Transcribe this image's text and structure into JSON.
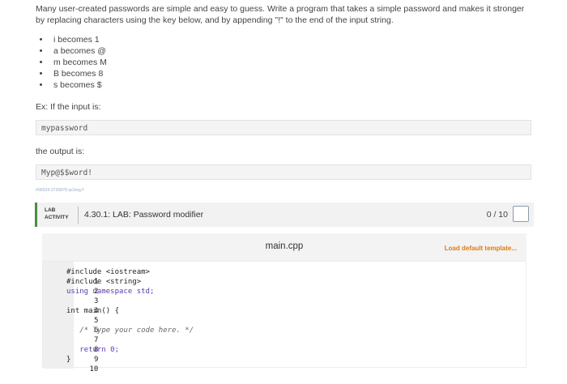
{
  "intro": "Many user-created passwords are simple and easy to guess. Write a program that takes a simple password and makes it stronger by replacing characters using the key below, and by appending \"!\" to the end of the input string.",
  "rules": [
    "i becomes 1",
    "a becomes @",
    "m becomes M",
    "B becomes 8",
    "s becomes $"
  ],
  "example_label": "Ex: If the input is:",
  "example_input": "mypassword",
  "output_label": "the output is:",
  "example_output": "Myp@$$word!",
  "tracking_id": "#96024.3735878.qx3zqy7",
  "lab": {
    "tag_line1": "LAB",
    "tag_line2": "ACTIVITY",
    "title": "4.30.1: LAB: Password modifier",
    "score": "0 / 10"
  },
  "editor": {
    "file_name": "main.cpp",
    "load_default": "Load default template...",
    "lines": [
      {
        "n": "1",
        "t": "#include <iostream>"
      },
      {
        "n": "2",
        "t": "#include <string>"
      },
      {
        "n": "3",
        "t": "using namespace std;"
      },
      {
        "n": "4",
        "t": ""
      },
      {
        "n": "5",
        "t": "int main() {"
      },
      {
        "n": "6",
        "t": ""
      },
      {
        "n": "7",
        "t": "   /* Type your code here. */"
      },
      {
        "n": "8",
        "t": ""
      },
      {
        "n": "9",
        "t": "   return 0;"
      },
      {
        "n": "10",
        "t": "}"
      }
    ]
  }
}
